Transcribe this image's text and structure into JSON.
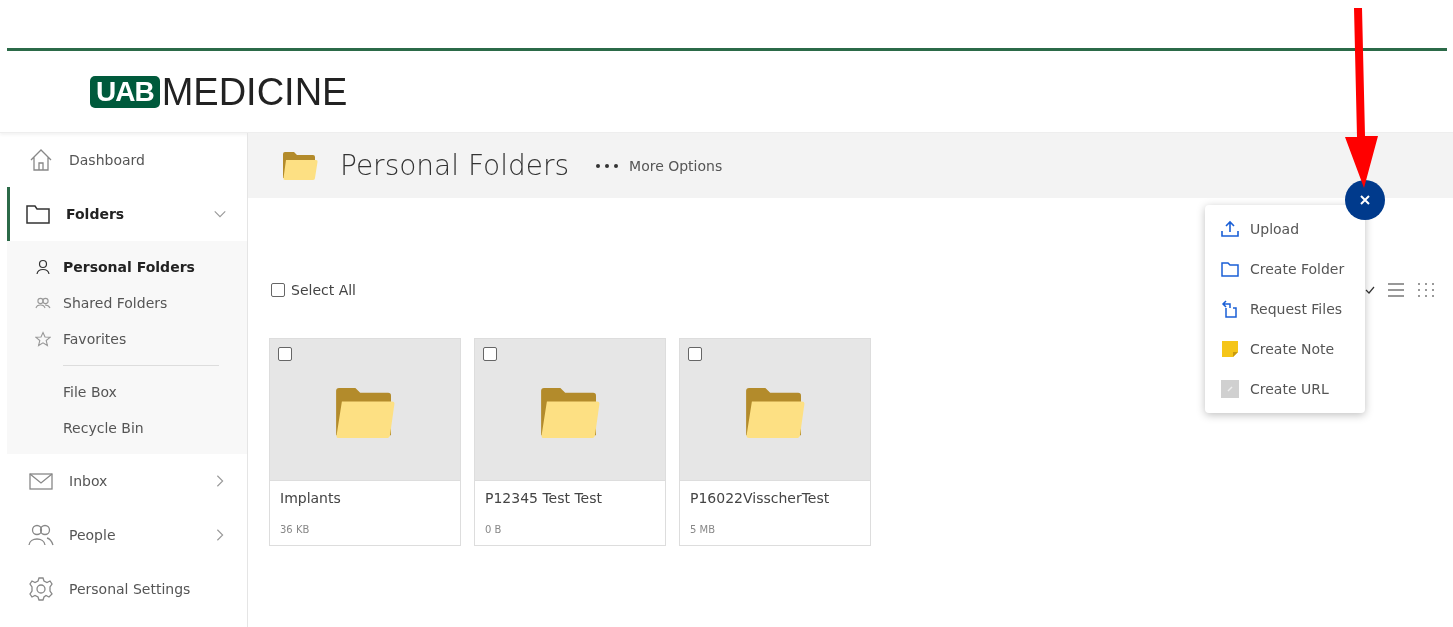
{
  "logo": {
    "mark": "UAB",
    "text": "MEDICINE"
  },
  "sidebar": {
    "items": [
      {
        "label": "Dashboard",
        "selected": false
      },
      {
        "label": "Folders",
        "selected": true,
        "expanded": true,
        "children": [
          {
            "label": "Personal Folders",
            "selected": true,
            "divider_before": false
          },
          {
            "label": "Shared Folders",
            "selected": false,
            "divider_before": false
          },
          {
            "label": "Favorites",
            "selected": false,
            "divider_before": false
          },
          {
            "label": "File Box",
            "selected": false,
            "divider_before": true
          },
          {
            "label": "Recycle Bin",
            "selected": false,
            "divider_before": false
          }
        ]
      },
      {
        "label": "Inbox",
        "selected": false,
        "expanded": false
      },
      {
        "label": "People",
        "selected": false,
        "expanded": false
      },
      {
        "label": "Personal Settings",
        "selected": false
      }
    ]
  },
  "page_header": {
    "title": "Personal Folders",
    "more": "More Options"
  },
  "select_all": {
    "label": "Select All",
    "checked": false
  },
  "folders": [
    {
      "name": "Implants",
      "size": "36 KB",
      "checked": false
    },
    {
      "name": "P12345 Test Test",
      "size": "0 B",
      "checked": false
    },
    {
      "name": "P16022VisscherTest",
      "size": "5 MB",
      "checked": false
    }
  ],
  "fab": {
    "open": true
  },
  "add_menu": [
    {
      "label": "Upload"
    },
    {
      "label": "Create Folder"
    },
    {
      "label": "Request Files"
    },
    {
      "label": "Create Note"
    },
    {
      "label": "Create URL"
    }
  ]
}
